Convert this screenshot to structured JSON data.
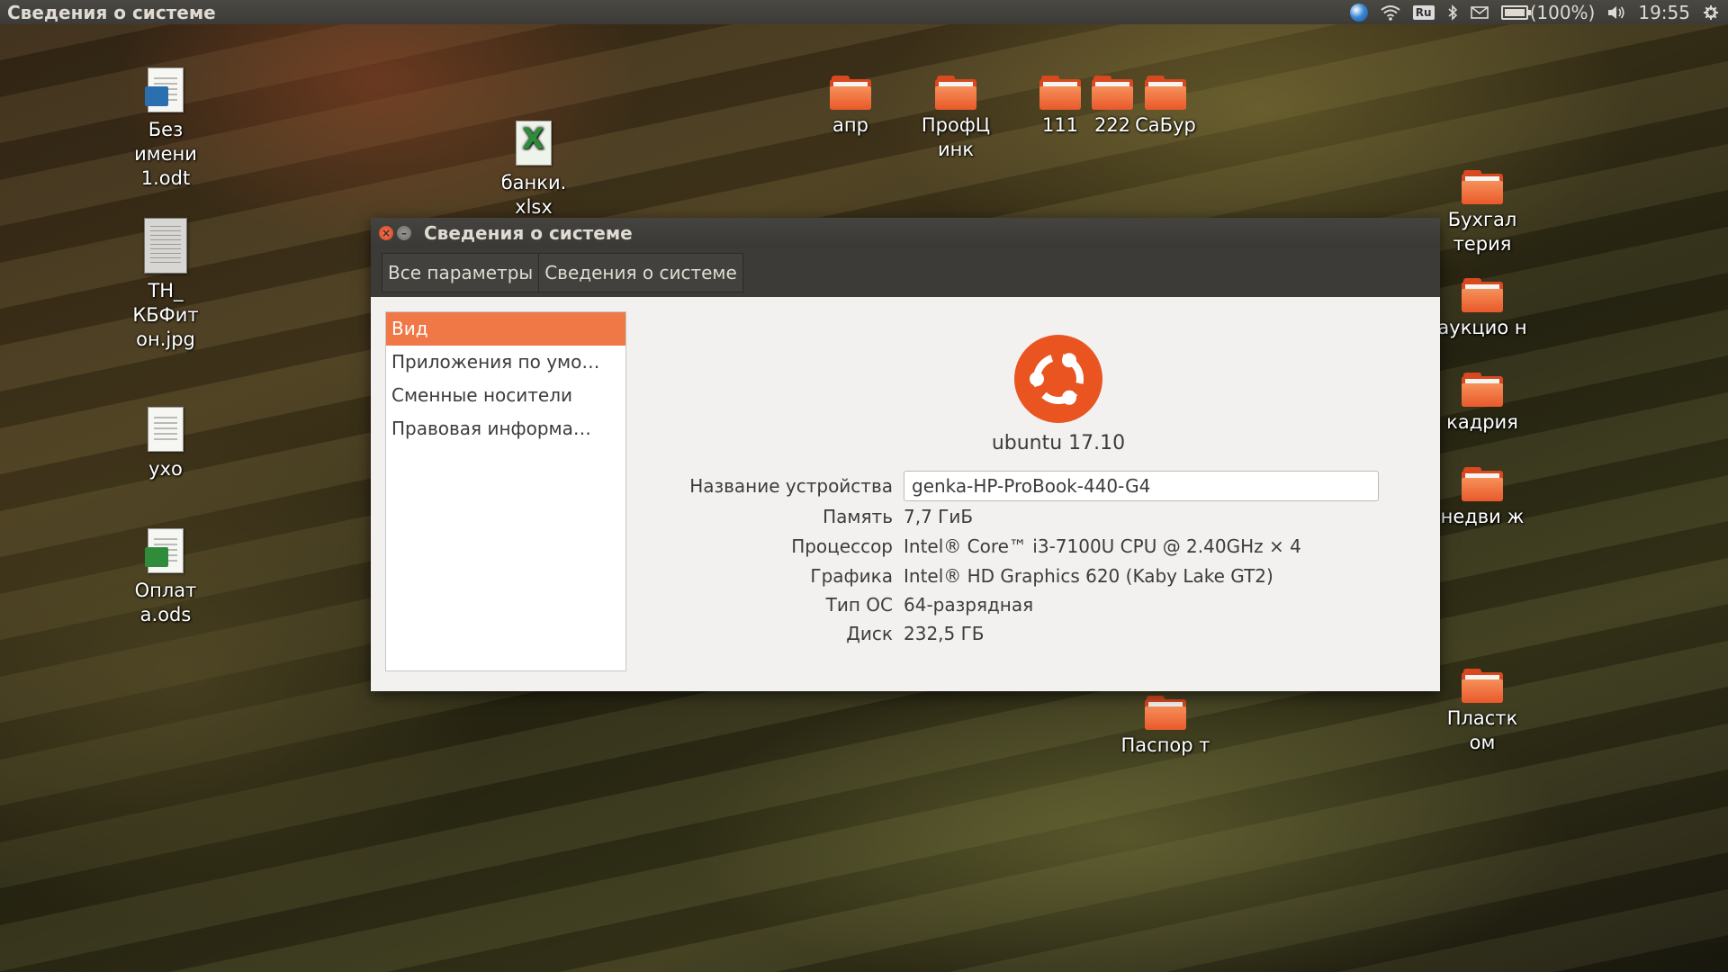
{
  "topbar": {
    "title": "Сведения о системе",
    "tray": {
      "keyboard_layout": "Ru",
      "battery_text": "(100%)",
      "battery_level": 1.0,
      "clock": "19:55",
      "icons": [
        "globe-icon",
        "wifi-icon",
        "keyboard-layout-icon",
        "bluetooth-icon",
        "mail-icon",
        "battery-icon",
        "volume-icon",
        "power-icon"
      ]
    }
  },
  "desktop": {
    "left_icons": [
      {
        "label": "Без имени 1.odt",
        "icon": "writer-document-icon"
      },
      {
        "label": "ТН_ КБФит он.jpg",
        "icon": "image-file-icon"
      },
      {
        "label": "ухо",
        "icon": "text-file-icon"
      },
      {
        "label": "Оплат а.ods",
        "icon": "spreadsheet-document-icon"
      }
    ],
    "bank_file": {
      "label": "банки. xlsx",
      "icon": "excel-file-icon"
    },
    "top_folders": [
      "апр",
      "ПрофЦ инк",
      "111",
      "222",
      "СаБур"
    ],
    "right_folders": [
      "Бухгал терия",
      "аукцио н",
      "кадрия",
      "недви ж",
      "Пластк ом"
    ],
    "bottom_folder": "Паспор т"
  },
  "window": {
    "title": "Сведения о системе",
    "breadcrumbs": [
      "Все параметры",
      "Сведения о системе"
    ],
    "sidebar": [
      {
        "label": "Вид",
        "active": true
      },
      {
        "label": "Приложения по умо…",
        "active": false
      },
      {
        "label": "Сменные носители",
        "active": false
      },
      {
        "label": "Правовая информа…",
        "active": false
      }
    ],
    "distro": "ubuntu 17.10",
    "logo_color": "#e95420",
    "device_name_label": "Название устройства",
    "device_name_value": "genka-HP-ProBook-440-G4",
    "info": [
      {
        "key": "Память",
        "value": "7,7 ГиБ"
      },
      {
        "key": "Процессор",
        "value": "Intel® Core™ i3-7100U CPU @ 2.40GHz × 4"
      },
      {
        "key": "Графика",
        "value": "Intel® HD Graphics 620 (Kaby Lake GT2)"
      },
      {
        "key": "Тип ОС",
        "value": "64-разрядная"
      },
      {
        "key": "Диск",
        "value": "232,5 ГБ"
      }
    ]
  }
}
